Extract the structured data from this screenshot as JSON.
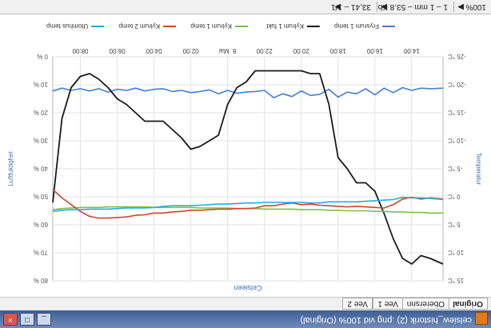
{
  "window": {
    "title": "celsiew_historik (2) .png vid 100% (Original)",
    "buttons": [
      "_",
      "□",
      "×"
    ]
  },
  "tabs": [
    {
      "label": "Original",
      "active": true
    },
    {
      "label": "Oberersnn",
      "active": false
    },
    {
      "label": "Vee 1",
      "active": false
    },
    {
      "label": "Vee 2",
      "active": false
    }
  ],
  "toolbar": {
    "zoom": "100%",
    "scale_label": "1 – 1 mm – 53.8 Kb",
    "position_label": "33,41 – 1/1",
    "arrow_left": "◀",
    "arrow_right": "▶"
  },
  "colors": {
    "frysrum1_temp": "#3f7fd6",
    "kylrum1_fukt": "#1a1a1a",
    "kylrum1_temp": "#7cc242",
    "kylrum2_temp": "#d2452b",
    "utomhus_temp": "#22aee0"
  },
  "chart_data": {
    "type": "line",
    "title": "Celsieen",
    "y_left_label": "Temperatur",
    "y_right_label": "Luftfuktighet",
    "y_left_ticks": [
      "-25 °C",
      "-20 °C",
      "-15 °C",
      "-10 °C",
      "-5 °C",
      "0 °C",
      "5 °C",
      "10 °C",
      "15 °C"
    ],
    "y_left_lim": [
      -25,
      15
    ],
    "y_right_ticks": [
      "0 %",
      "10 %",
      "20 %",
      "30 %",
      "40 %",
      "50 %",
      "60 %",
      "70 %",
      "80 %"
    ],
    "y_right_lim": [
      0,
      80
    ],
    "x_ticks": [
      "14:00",
      "16:00",
      "18:00",
      "20:00",
      "22:00",
      "8. Mai",
      "02:00",
      "04:00",
      "06:00",
      "08:00"
    ],
    "legend": [
      "Frysrum 1 temp",
      "Kylrum 1 fukt",
      "Kylrum 1 temp",
      "Kylrum 2 temp",
      "Utomhus temp"
    ],
    "legend_position": "top",
    "grid": true,
    "x_hours": [
      12.3,
      13.0,
      13.5,
      14.0,
      14.5,
      15.0,
      15.5,
      16.0,
      16.5,
      17.0,
      17.5,
      18.0,
      18.5,
      19.0,
      19.5,
      20.0,
      20.5,
      21.0,
      21.5,
      22.0,
      22.5,
      23.0,
      23.5,
      24.0,
      24.5,
      25.0,
      25.5,
      26.0,
      26.5,
      27.0,
      27.5,
      28.0,
      28.5,
      29.0,
      29.5,
      30.0,
      30.5,
      31.0,
      31.5,
      32.0,
      32.5,
      33.0,
      33.5
    ],
    "series": [
      {
        "name": "Frysrum 1 temp",
        "axis": "left",
        "color": "#3f7fd6",
        "values": [
          -19.4,
          -19.3,
          -19.4,
          -19.0,
          -19.5,
          -18.6,
          -19.4,
          -18.2,
          -19.3,
          -18.4,
          -18.7,
          -17.8,
          -19.2,
          -18.3,
          -18.1,
          -18.9,
          -17.9,
          -18.4,
          -17.7,
          -19.0,
          -18.8,
          -18.7,
          -18.5,
          -19.0,
          -18.4,
          -19.1,
          -18.8,
          -18.6,
          -19.0,
          -18.8,
          -19.3,
          -19.2,
          -18.9,
          -19.4,
          -19.0,
          -19.2,
          -18.7,
          -19.3,
          -18.9,
          -19.3,
          -19.0,
          -19.4,
          -18.9
        ]
      },
      {
        "name": "Kylrum 1 fukt",
        "axis": "right",
        "color": "#1a1a1a",
        "values": [
          74,
          72,
          71,
          74,
          72,
          65,
          56,
          48,
          45,
          45,
          40,
          36,
          17,
          6,
          6,
          5,
          5,
          5,
          5,
          5,
          5,
          9,
          11,
          17,
          28,
          30,
          32,
          33,
          29,
          26,
          23,
          23,
          23,
          20,
          17,
          15,
          11,
          8,
          6,
          7,
          11,
          22,
          52
        ]
      },
      {
        "name": "Kylrum 1 temp",
        "axis": "left",
        "color": "#7cc242",
        "values": [
          2.9,
          2.9,
          2.8,
          2.8,
          2.7,
          2.7,
          2.6,
          2.6,
          2.5,
          2.5,
          2.5,
          2.4,
          2.4,
          2.3,
          2.3,
          2.3,
          2.2,
          2.2,
          2.2,
          2.2,
          2.1,
          2.1,
          2.1,
          2.0,
          2.0,
          2.0,
          2.0,
          1.9,
          1.9,
          1.9,
          1.9,
          1.9,
          1.8,
          1.8,
          1.8,
          1.8,
          1.8,
          1.9,
          1.9,
          1.9,
          2.0,
          2.1,
          2.3
        ]
      },
      {
        "name": "Kylrum 2 temp",
        "axis": "left",
        "color": "#d2452b",
        "values": [
          0.4,
          0.2,
          0.4,
          0.1,
          0.4,
          1.4,
          2.0,
          1.9,
          1.8,
          1.7,
          1.8,
          1.7,
          1.6,
          1.5,
          1.3,
          1.4,
          1.1,
          1.3,
          1.6,
          1.6,
          2.0,
          2.1,
          2.1,
          2.2,
          2.2,
          2.3,
          2.4,
          2.4,
          2.6,
          2.7,
          2.9,
          2.9,
          3.2,
          3.3,
          3.6,
          3.7,
          3.8,
          3.8,
          3.5,
          2.6,
          1.4,
          0.2,
          -1.3
        ]
      },
      {
        "name": "Utomhus temp",
        "axis": "left",
        "color": "#22aee0",
        "values": [
          0.5,
          0.3,
          0.2,
          0.2,
          0.1,
          0.5,
          0.6,
          0.7,
          0.8,
          0.9,
          0.9,
          0.9,
          0.9,
          1.1,
          1.1,
          1.0,
          1.0,
          1.0,
          1.0,
          1.0,
          1.1,
          1.1,
          1.2,
          1.3,
          1.3,
          1.4,
          1.5,
          1.6,
          1.6,
          1.6,
          1.7,
          1.9,
          2.0,
          2.0,
          2.0,
          2.1,
          2.2,
          2.2,
          2.2,
          2.3,
          2.3,
          2.4,
          2.6
        ]
      }
    ]
  }
}
